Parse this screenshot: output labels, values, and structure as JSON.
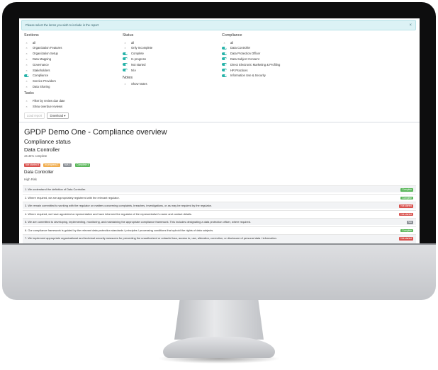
{
  "alert": {
    "text": "Please select the items you wish to include in the report",
    "close": "×"
  },
  "sections": {
    "title": "Sections",
    "items": [
      {
        "label": "all",
        "on": false
      },
      {
        "label": "Organization Features",
        "on": false
      },
      {
        "label": "Organization Setup",
        "on": false
      },
      {
        "label": "Data Mapping",
        "on": false
      },
      {
        "label": "Governance",
        "on": false
      },
      {
        "label": "Stakeholders",
        "on": false
      },
      {
        "label": "Compliance",
        "on": true
      },
      {
        "label": "Service Providers",
        "on": false
      },
      {
        "label": "Data Sharing",
        "on": false
      }
    ]
  },
  "status": {
    "title": "Status",
    "items": [
      {
        "label": "all",
        "on": false
      },
      {
        "label": "Only Incomplete",
        "on": false
      },
      {
        "label": "Complete",
        "on": true
      },
      {
        "label": "In progress",
        "on": true
      },
      {
        "label": "Not started",
        "on": true
      },
      {
        "label": "N/A",
        "on": true
      }
    ]
  },
  "notes": {
    "title": "Notes",
    "items": [
      {
        "label": "Show Notes",
        "on": false
      }
    ]
  },
  "compliance": {
    "title": "Compliance",
    "items": [
      {
        "label": "all",
        "on": false
      },
      {
        "label": "Data Controller",
        "on": true
      },
      {
        "label": "Data Protection Officer",
        "on": true
      },
      {
        "label": "Data Subject Consent",
        "on": true
      },
      {
        "label": "Direct Electronic Marketing & Profiling",
        "on": true
      },
      {
        "label": "HR Practices",
        "on": true
      },
      {
        "label": "Information Use & Security",
        "on": true
      }
    ]
  },
  "tasks": {
    "title": "Tasks",
    "items": [
      {
        "label": "Filter by review due date",
        "on": false
      },
      {
        "label": "Show overdue reviews",
        "on": false
      }
    ]
  },
  "buttons": {
    "load": "Load report",
    "download": "Download ▾"
  },
  "report": {
    "title": "GPDP Demo One - Compliance overview",
    "subtitle": "Compliance status",
    "section": "Data Controller",
    "percent": "44.44% complete",
    "badges": [
      {
        "label": "Not started 4",
        "color": "#d9534f"
      },
      {
        "label": "In progress 1",
        "color": "#f0ad4e"
      },
      {
        "label": "N/A 1",
        "color": "#8a8f95"
      },
      {
        "label": "Complete 4",
        "color": "#5cb85c"
      }
    ],
    "group_title": "Data Controller",
    "risk": "High Risk",
    "rows": [
      {
        "text": "1. We understand the definition of Data Controller.",
        "status": "Complete",
        "color": "#5cb85c"
      },
      {
        "text": "2. Where required, we are appropriately registered with the relevant regulator.",
        "status": "Complete",
        "color": "#5cb85c"
      },
      {
        "text": "3. We remain committed to working with the regulator on matters concerning complaints, breaches, investigations, or as may be required by the regulator.",
        "status": "Not started",
        "color": "#d9534f"
      },
      {
        "text": "4. Where required, we have appointed a representative and have informed the regulator of the representative's name and contact details.",
        "status": "Not started",
        "color": "#d9534f"
      },
      {
        "text": "5. We are committed to developing, implementing, monitoring, and maintaining the appropriate compliance framework. This includes designating a data protection officer, where required.",
        "status": "N/A",
        "color": "#8a8f95"
      },
      {
        "text": "6. Our compliance framework is guided by the relevant data protection standards / principles / processing conditions that uphold the rights of data subjects.",
        "status": "Complete",
        "color": "#5cb85c"
      },
      {
        "text": "7. We implement appropriate organizational and technical security measures for preventing the unauthorized or unlawful loss, access to, use, alteration, correction, or disclosure of personal data / information.",
        "status": "Not started",
        "color": "#d9534f"
      }
    ]
  }
}
